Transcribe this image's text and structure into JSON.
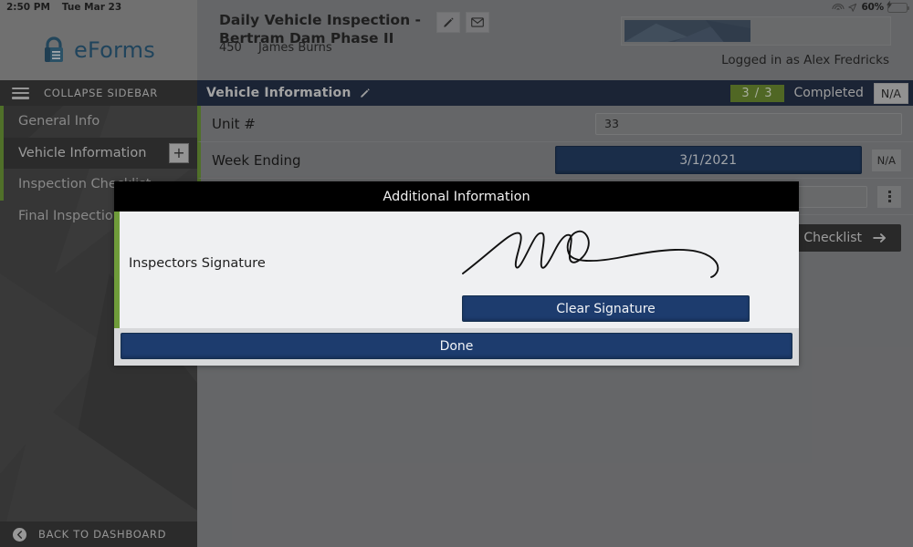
{
  "statusbar": {
    "time": "2:50 PM",
    "date": "Tue Mar 23",
    "battery_percent": "60%",
    "wifi_icon": "wifi-icon",
    "location_icon": "location-arrow-icon",
    "battery_icon": "battery-charging-icon"
  },
  "sidebar": {
    "brand": "eForms",
    "brand_icon": "lock-icon",
    "collapse_label": "COLLAPSE SIDEBAR",
    "menu_icon": "hamburger-icon",
    "items": [
      {
        "label": "General Info",
        "active": false
      },
      {
        "label": "Vehicle Information",
        "active": true,
        "add_label": "+"
      },
      {
        "label": "Inspection Checklist",
        "active": false
      },
      {
        "label": "Final Inspection",
        "active": false
      }
    ],
    "back_label": "BACK TO DASHBOARD",
    "back_icon": "back-arrow-circle-icon"
  },
  "header": {
    "title": "Daily Vehicle Inspection - Bertram Dam Phase II",
    "sub_number": "450",
    "sub_name": "James  Burns",
    "edit_icon": "pencil-icon",
    "mail_icon": "envelope-icon",
    "logged_in": "Logged in as Alex Fredricks"
  },
  "content": {
    "section_title": "Vehicle Information",
    "section_edit_icon": "pencil-icon",
    "progress_badge": "3 / 3",
    "status": "Completed",
    "na_label": "N/A",
    "rows": [
      {
        "label": "Unit #",
        "value": "33",
        "control": "text"
      },
      {
        "label": "Week Ending",
        "value": "3/1/2021",
        "control": "button",
        "na_label": "N/A"
      }
    ],
    "menu_icon": "vertical-dots-icon",
    "next_button": "Inspection Checklist",
    "next_icon": "arrow-right-icon"
  },
  "modal": {
    "title": "Additional Information",
    "signature_label": "Inspectors Signature",
    "clear_button": "Clear Signature",
    "done_button": "Done",
    "signature_icon": "handwritten-signature"
  },
  "colors": {
    "accent_green": "#6f9c3a",
    "badge_green": "#6f8f33",
    "primary_blue": "#1d3c6e",
    "header_navy": "#26334a",
    "brand_blue": "#2d5f80"
  }
}
